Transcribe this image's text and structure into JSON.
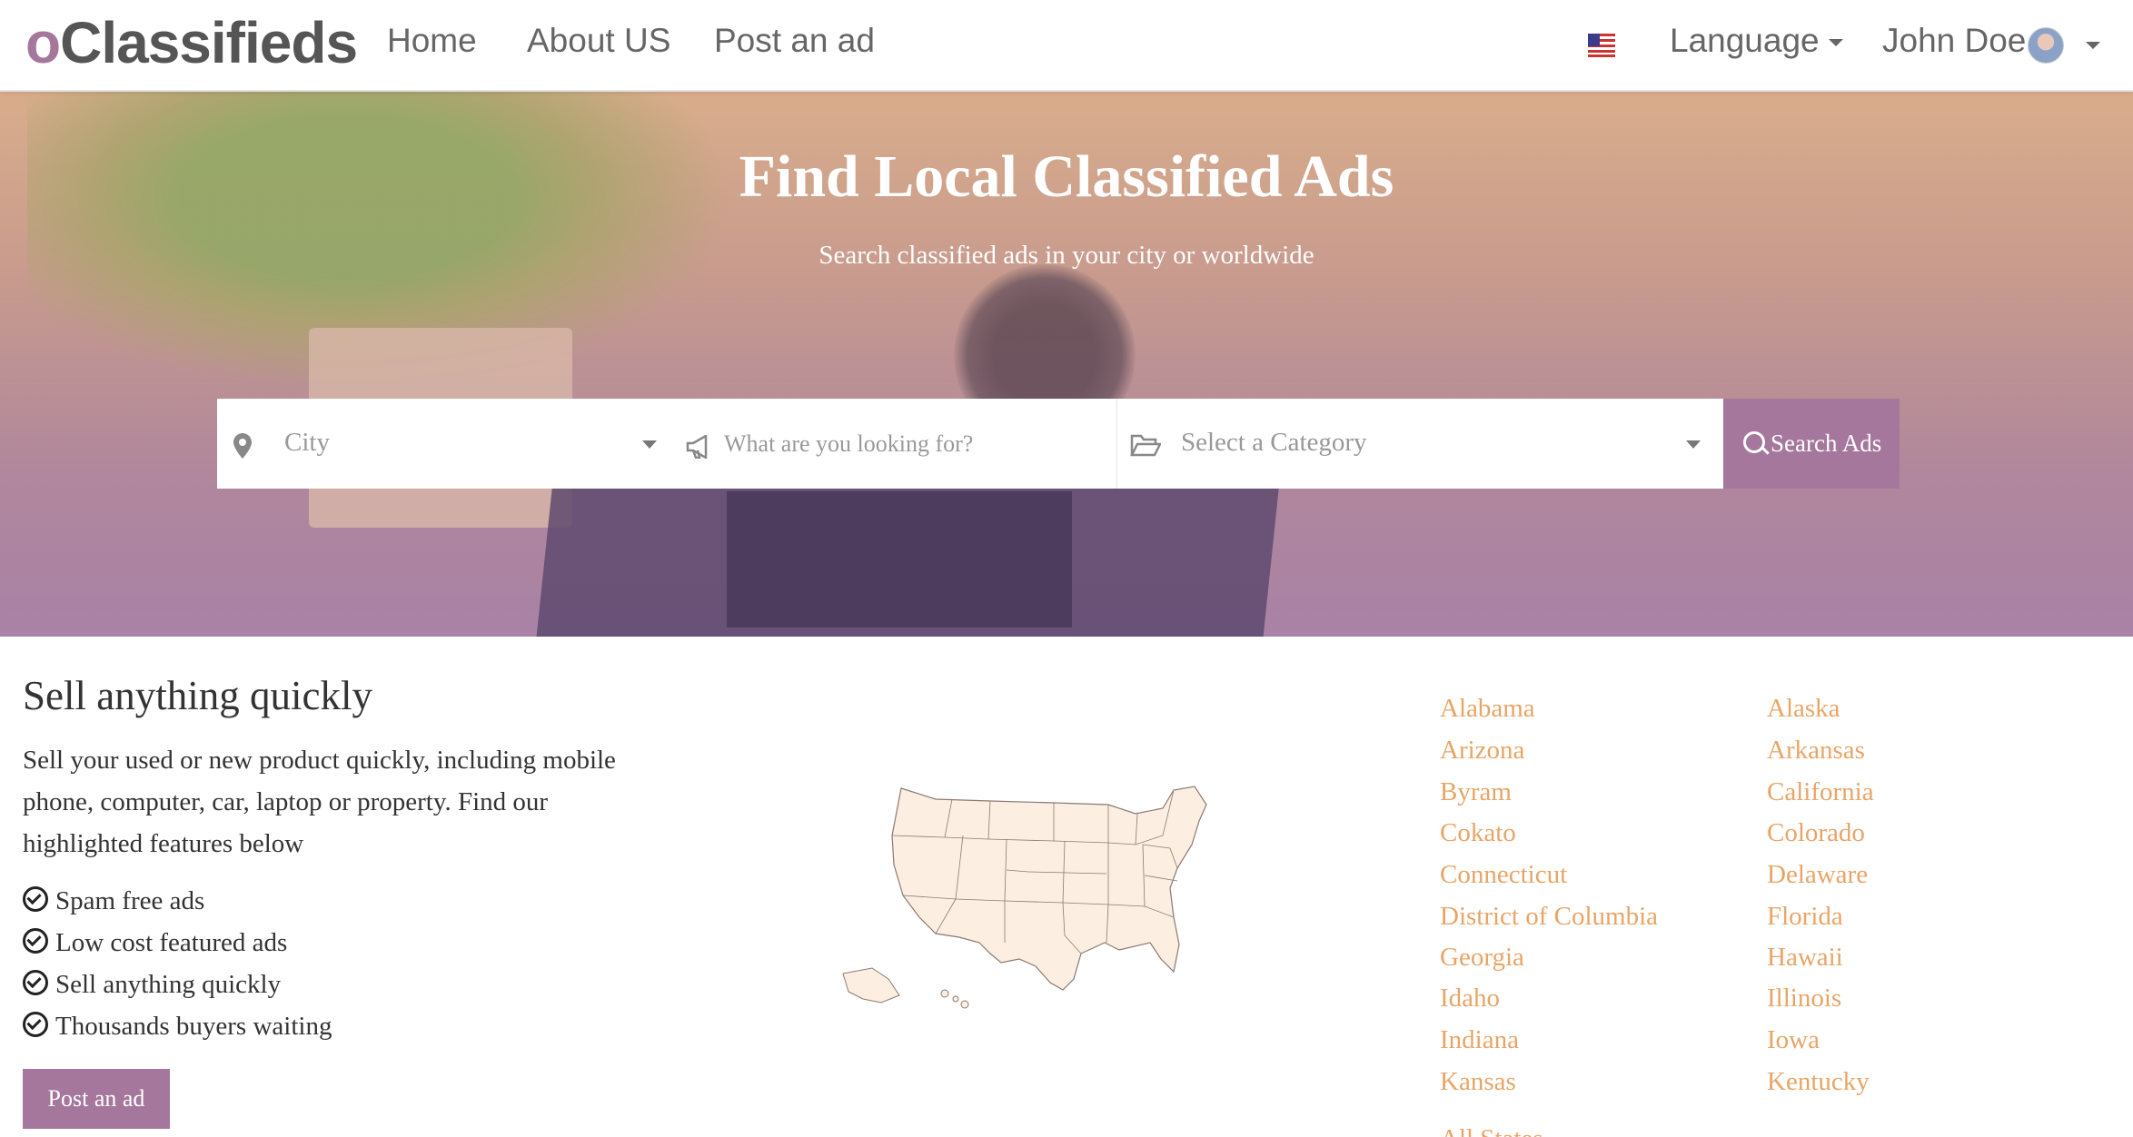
{
  "nav": {
    "brand_prefix": "o",
    "brand_rest": "Classifieds",
    "links": [
      "Home",
      "About US",
      "Post an ad"
    ],
    "language_label": "Language",
    "user_name": "John Doe"
  },
  "hero": {
    "title": "Find Local Classified Ads",
    "subtitle": "Search classified ads in your city or worldwide",
    "city_placeholder": "City",
    "query_placeholder": "What are you looking for?",
    "category_placeholder": "Select a Category",
    "search_button": "Search Ads"
  },
  "sell": {
    "heading": "Sell anything quickly",
    "description": "Sell your used or new product quickly, including mobile phone, computer, car, laptop or property. Find our highlighted features below",
    "features": [
      "Spam free ads",
      "Low cost featured ads",
      "Sell anything quickly",
      "Thousands buyers waiting"
    ],
    "post_button": "Post an ad"
  },
  "states": {
    "left": [
      "Alabama",
      "Arizona",
      "Byram",
      "Cokato",
      "Connecticut",
      "District of Columbia",
      "Georgia",
      "Idaho",
      "Indiana",
      "Kansas"
    ],
    "right": [
      "Alaska",
      "Arkansas",
      "California",
      "Colorado",
      "Delaware",
      "Florida",
      "Hawaii",
      "Illinois",
      "Iowa",
      "Kentucky"
    ],
    "all_states_link": "All States"
  },
  "colors": {
    "accent": "#a5779c",
    "link": "#e8a567",
    "map_fill": "#fdeee2"
  },
  "icons": [
    "map-marker-icon",
    "megaphone-icon",
    "folder-open-icon",
    "search-icon",
    "check-circle-icon",
    "us-flag-icon",
    "caret-down-icon"
  ]
}
